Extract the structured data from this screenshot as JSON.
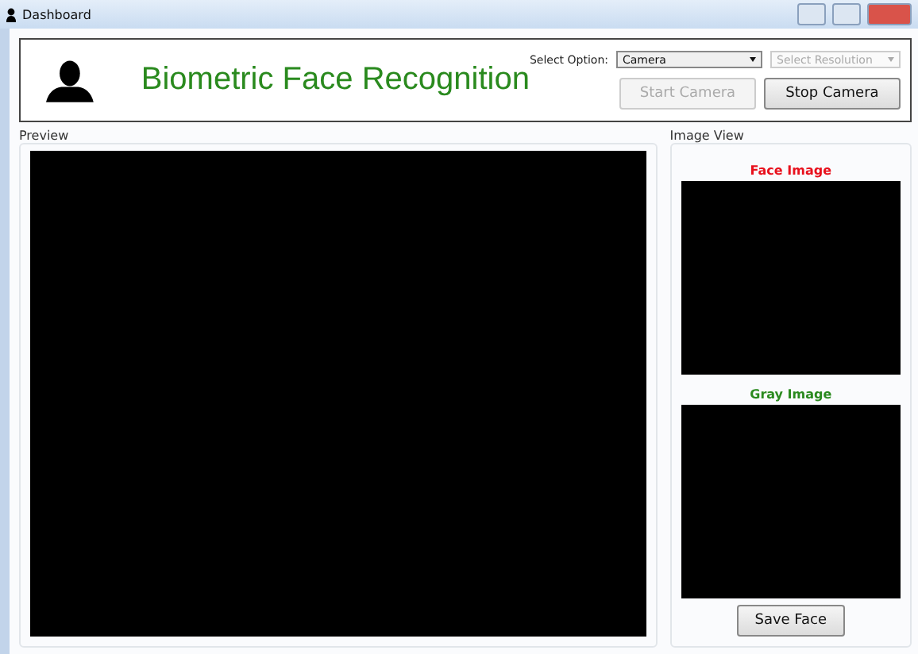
{
  "window": {
    "title": "Dashboard"
  },
  "header": {
    "title": "Biometric Face Recognition",
    "select_label": "Select Option:",
    "source_select": {
      "value": "Camera",
      "disabled": false
    },
    "resolution_select": {
      "placeholder": "Select Resolution",
      "disabled": true
    },
    "buttons": [
      {
        "label": "Start Camera",
        "disabled": true
      },
      {
        "label": "Stop Camera",
        "disabled": false
      }
    ]
  },
  "preview": {
    "title": "Preview"
  },
  "image_view": {
    "title": "Image View",
    "images": [
      {
        "label": "Face Image",
        "color": "#e8101c"
      },
      {
        "label": "Gray Image",
        "color": "#2a8a1e"
      }
    ],
    "save_button": {
      "label": "Save Face",
      "disabled": false
    }
  }
}
